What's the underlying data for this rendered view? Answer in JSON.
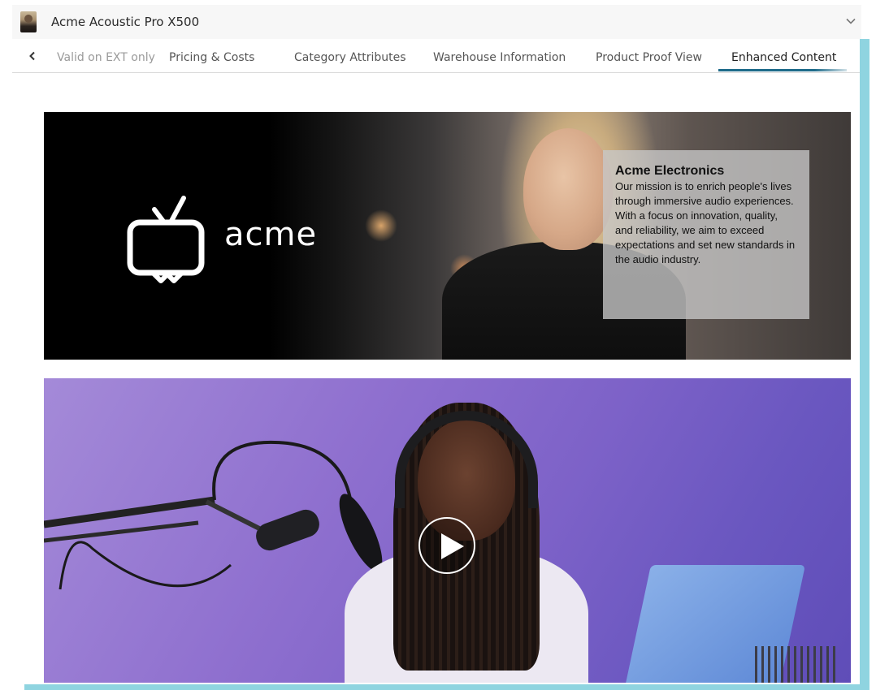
{
  "header": {
    "title": "Acme Acoustic Pro X500",
    "avatar_icon": "product-thumbnail",
    "expand_icon": "chevron-down-icon"
  },
  "tabs": {
    "prev_icon": "chevron-left-icon",
    "items": [
      {
        "label": "Valid on EXT only",
        "state": "partial"
      },
      {
        "label": "Pricing & Costs",
        "state": "normal"
      },
      {
        "label": "Category Attributes",
        "state": "normal"
      },
      {
        "label": "Warehouse Information",
        "state": "normal"
      },
      {
        "label": "Product Proof View",
        "state": "normal"
      },
      {
        "label": "Enhanced Content",
        "state": "active"
      }
    ],
    "active_color": "#1e6b8a"
  },
  "banner": {
    "logo_icon": "tv-icon",
    "logo_text": "acme",
    "info_title": "Acme Electronics",
    "info_text": "Our mission is to enrich people's lives through immersive audio experiences. With a focus on innovation, quality, and reliability, we aim to exceed expectations and set new standards in the audio industry."
  },
  "video": {
    "play_icon": "play-icon"
  },
  "colors": {
    "accent": "#8fd4e0",
    "tab_underline": "#1e6b8a"
  }
}
